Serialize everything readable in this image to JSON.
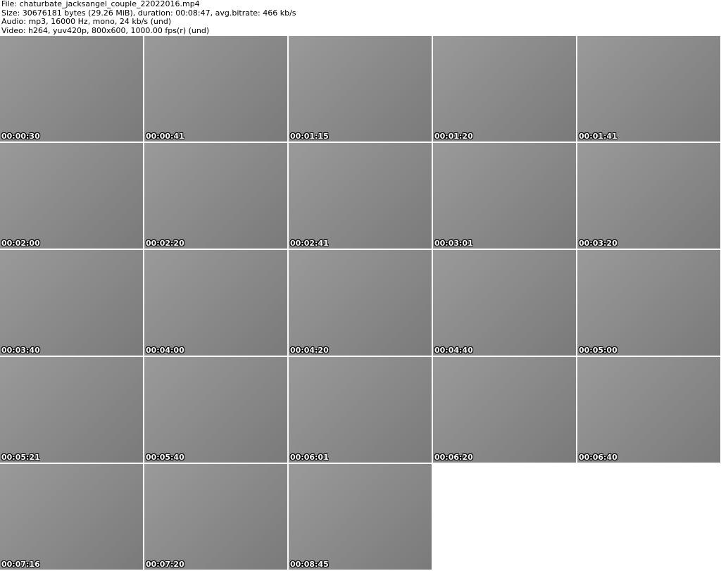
{
  "header": {
    "file": "File: chaturbate_jacksangel_couple_22022016.mp4",
    "size": "Size: 30676181 bytes (29.26 MiB), duration: 00:08:47, avg.bitrate: 466 kb/s",
    "audio": "Audio: mp3, 16000 Hz, mono, 24 kb/s (und)",
    "video": "Video: h264, yuv420p, 800x600, 1000.00 fps(r) (und)"
  },
  "thumbnails": [
    "00:00:30",
    "00:00:41",
    "00:01:15",
    "00:01:20",
    "00:01:41",
    "00:02:00",
    "00:02:20",
    "00:02:41",
    "00:03:01",
    "00:03:20",
    "00:03:40",
    "00:04:00",
    "00:04:20",
    "00:04:40",
    "00:05:00",
    "00:05:21",
    "00:05:40",
    "00:06:01",
    "00:06:20",
    "00:06:40",
    "00:07:16",
    "00:07:20",
    "00:08:45"
  ]
}
